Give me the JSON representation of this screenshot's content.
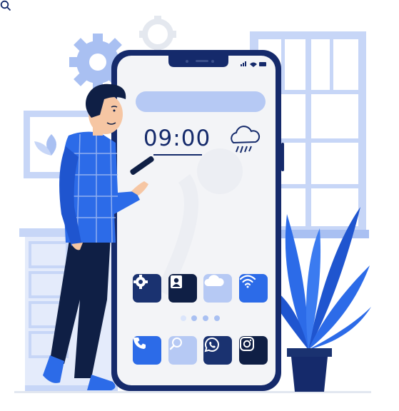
{
  "phone": {
    "clock": {
      "time": "09:00"
    },
    "weather_icon": "cloud-rain-icon",
    "search_icon": "search-icon",
    "page_dots": {
      "count": 4,
      "active_index": 1
    },
    "app_grid": [
      {
        "icon": "settings-gear-icon",
        "bg": "#1a3270"
      },
      {
        "icon": "contact-person-icon",
        "bg": "#0f1f45"
      },
      {
        "icon": "cloud-icon",
        "bg": "#b6c9f4"
      },
      {
        "icon": "wifi-icon",
        "bg": "#2c6be8"
      }
    ],
    "dock": [
      {
        "icon": "phone-icon",
        "bg": "#2c6be8"
      },
      {
        "icon": "search-icon",
        "bg": "#b6c9f4"
      },
      {
        "icon": "whatsapp-icon",
        "bg": "#1a3270"
      },
      {
        "icon": "instagram-icon",
        "bg": "#0f1f45"
      }
    ]
  },
  "colors": {
    "navy": "#152a6b",
    "dark_navy": "#0f1f45",
    "blue": "#2c6be8",
    "light_blue": "#b6c9f4",
    "pale_blue": "#dbe5fb",
    "screen": "#f3f4f7"
  }
}
